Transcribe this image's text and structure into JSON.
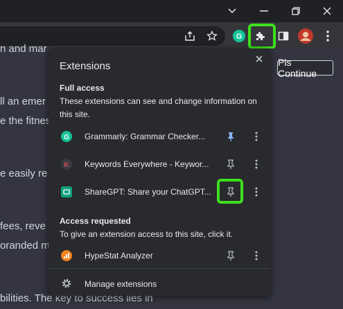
{
  "window": {
    "minimize_icon": "chevron-down",
    "controls": [
      "minimize",
      "restore",
      "close"
    ]
  },
  "toolbar": {
    "icons": [
      "share-icon",
      "star-icon",
      "grammarly-icon",
      "extensions-icon",
      "sidebar-icon",
      "avatar",
      "menu-icon"
    ],
    "highlight_color": "#3ee01e"
  },
  "page": {
    "lines": [
      "n and mar",
      "ll an emer",
      "e the fitnes",
      "e easily re",
      "fees, reve",
      "oranded m",
      "bilities. The key to success lies in"
    ],
    "pls_continue": "Pls Continue"
  },
  "popup": {
    "title": "Extensions",
    "full_access": {
      "heading": "Full access",
      "description": "These extensions can see and change information on this site.",
      "items": [
        {
          "name": "Grammarly: Grammar Checker...",
          "icon_color": "#15c39a",
          "pinned": true
        },
        {
          "name": "Keywords Everywhere - Keywor...",
          "icon_color": "#3a3b3f",
          "pinned": false
        },
        {
          "name": "ShareGPT: Share your ChatGPT...",
          "icon_color": "#10a37f",
          "pinned": false
        }
      ]
    },
    "access_requested": {
      "heading": "Access requested",
      "description": "To give an extension access to this site, click it.",
      "items": [
        {
          "name": "HypeStat Analyzer",
          "icon_color": "#f58220",
          "pinned": false
        }
      ]
    },
    "manage": "Manage extensions"
  }
}
